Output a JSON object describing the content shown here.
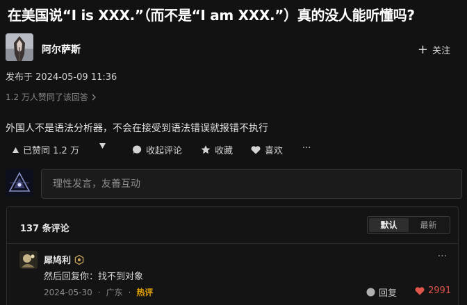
{
  "question": {
    "title": "在美国说“I is XXX.”（而不是“I am XXX.”）真的没人能听懂吗?"
  },
  "author": {
    "name": "阿尔萨斯",
    "follow_label": "关注"
  },
  "answer": {
    "published": "发布于 2024-05-09 11:36",
    "agree_summary": "1.2 万人赞同了该回答",
    "body": "外国人不是语法分析器，不会在接受到语法错误就报错不执行"
  },
  "actions": {
    "agreed_label": "已赞同 1.2 万",
    "collapse_comments": "收起评论",
    "favorite": "收藏",
    "like": "喜欢",
    "more": "···"
  },
  "comment_input": {
    "placeholder": "理性发言，友善互动"
  },
  "comments": {
    "count_label": "137 条评论",
    "sort_default": "默认",
    "sort_latest": "最新",
    "items": [
      {
        "user": "犀鸠利",
        "text": "然后回复你：找不到对象",
        "date": "2024-05-30",
        "location": "广东",
        "badge": "热评",
        "reply_label": "回复",
        "likes": "2991"
      }
    ]
  },
  "colors": {
    "background": "#121212",
    "like_red": "#e0554c",
    "hot_gold": "#e0a100"
  }
}
